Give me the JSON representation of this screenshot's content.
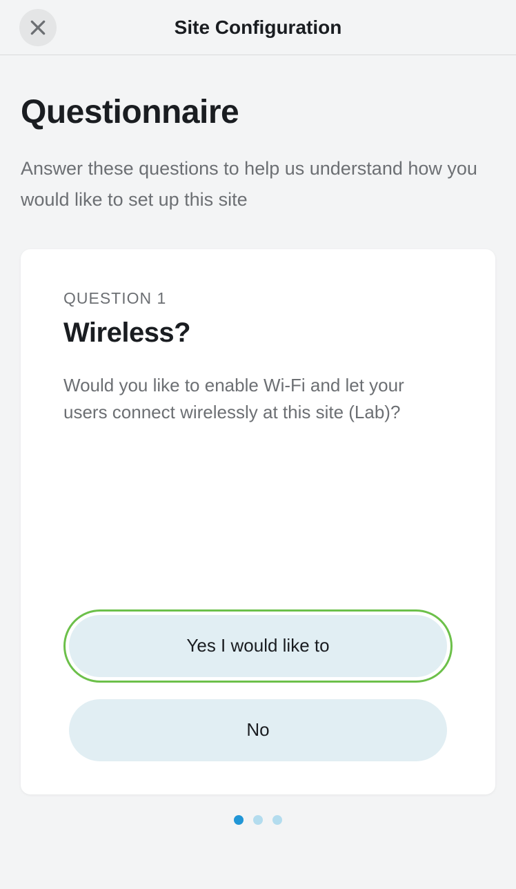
{
  "header": {
    "title": "Site Configuration"
  },
  "page": {
    "title": "Questionnaire",
    "subtitle": "Answer these questions to help us understand how you would like to set up this site"
  },
  "question": {
    "label": "QUESTION 1",
    "title": "Wireless?",
    "body": "Would you like to enable Wi-Fi and let your users connect wirelessly at this site (Lab)?",
    "answers": {
      "yes": "Yes I would like to",
      "no": "No"
    },
    "selected": "yes"
  },
  "pager": {
    "total": 3,
    "current": 1
  }
}
